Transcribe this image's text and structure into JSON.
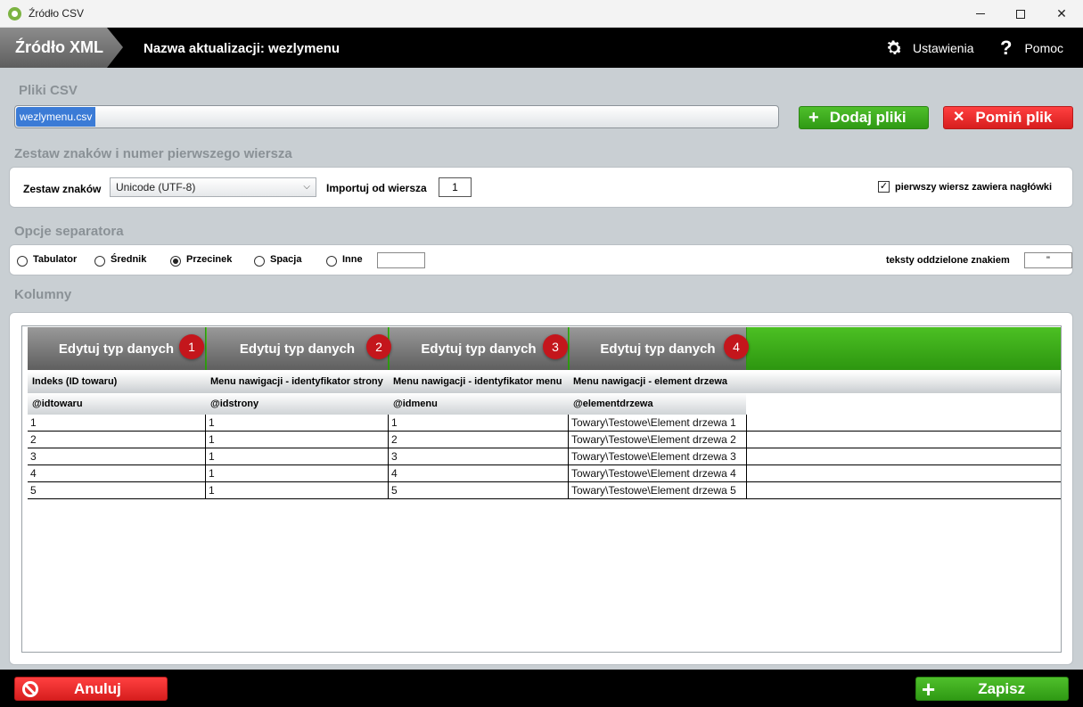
{
  "window": {
    "title": "Źródło CSV",
    "minimize_glyph": "",
    "close_glyph": "✕"
  },
  "header": {
    "breadcrumb": "Źródło XML",
    "update_name": "Nazwa aktualizacji: wezlymenu",
    "settings_label": "Ustawienia",
    "help_label": "Pomoc",
    "settings_icon": "gear-icon",
    "help_icon": "question-icon"
  },
  "files": {
    "section_title": "Pliki CSV",
    "file_name": "wezlymenu.csv",
    "add_label": "Dodaj pliki",
    "add_icon": "+",
    "skip_label": "Pomiń plik",
    "skip_icon": "✕"
  },
  "charset": {
    "section_title": "Zestaw znaków i numer pierwszego wiersza",
    "charset_label": "Zestaw znaków",
    "charset_value": "Unicode (UTF-8)",
    "import_label": "Importuj od wiersza",
    "import_value": "1",
    "header_checkbox_label": "pierwszy wiersz zawiera nagłówki",
    "header_checkbox_mark": "✓",
    "header_checkbox_checked": true
  },
  "separator": {
    "section_title": "Opcje separatora",
    "options": [
      {
        "label": "Tabulator",
        "checked": false
      },
      {
        "label": "Średnik",
        "checked": false
      },
      {
        "label": "Przecinek",
        "checked": true
      },
      {
        "label": "Spacja",
        "checked": false
      },
      {
        "label": "Inne",
        "checked": false
      }
    ],
    "other_value": "",
    "text_qualifier_label": "teksty oddzielone znakiem",
    "text_qualifier_value": "\""
  },
  "columns": {
    "section_title": "Kolumny",
    "edit_label": "Edytuj typ danych",
    "badges": [
      "1",
      "2",
      "3",
      "4"
    ],
    "headers": [
      "Indeks (ID towaru)",
      "Menu nawigacji - identyfikator strony",
      "Menu nawigacji - identyfikator menu",
      "Menu nawigacji - element drzewa"
    ],
    "variables": [
      "@idtowaru",
      "@idstrony",
      "@idmenu",
      "@elementdrzewa"
    ],
    "rows": [
      [
        "1",
        "1",
        "1",
        "Towary\\Testowe\\Element drzewa 1"
      ],
      [
        "2",
        "1",
        "2",
        "Towary\\Testowe\\Element drzewa 2"
      ],
      [
        "3",
        "1",
        "3",
        "Towary\\Testowe\\Element drzewa 3"
      ],
      [
        "4",
        "1",
        "4",
        "Towary\\Testowe\\Element drzewa 4"
      ],
      [
        "5",
        "1",
        "5",
        "Towary\\Testowe\\Element drzewa 5"
      ]
    ]
  },
  "footer": {
    "cancel_label": "Anuluj",
    "save_label": "Zapisz",
    "save_icon": "+"
  },
  "colors": {
    "accent_green": "#2f9a14",
    "danger_red": "#d71e1e",
    "badge_red": "#c4161c",
    "header_black": "#000000"
  }
}
